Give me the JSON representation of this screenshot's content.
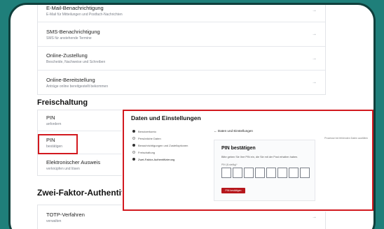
{
  "notifications": {
    "items": [
      {
        "title": "E-Mail-Benachrichtigung",
        "subtitle": "E-Mail für Mitteilungen und Postfach-Nachrichten"
      },
      {
        "title": "SMS-Benachrichtigung",
        "subtitle": "SMS für anstehende Termine"
      },
      {
        "title": "Online-Zustellung",
        "subtitle": "Bescheide, Nachweise und Schreiben"
      },
      {
        "title": "Online-Bereitstellung",
        "subtitle": "Anträge online bereitgestellt bekommen"
      }
    ],
    "arrow": "→"
  },
  "freischaltung": {
    "heading": "Freischaltung",
    "items": [
      {
        "title": "PIN",
        "subtitle": "anfordern"
      },
      {
        "title": "PIN",
        "subtitle": "bestätigen"
      },
      {
        "title": "Elektronischer Ausweis",
        "subtitle": "verknüpfen und lösen"
      }
    ]
  },
  "zwei_faktor": {
    "heading": "Zwei-Faktor-Authentif",
    "items": [
      {
        "title": "TOTP-Verfahren",
        "subtitle": "verwalten"
      }
    ]
  },
  "modal": {
    "title": "Daten und Einstellungen",
    "steps": [
      {
        "label": "Benutzerkonto",
        "state": "filled"
      },
      {
        "label": "Persönliche Daten",
        "state": "empty"
      },
      {
        "label": "Benachrichtigungen und Zustelloptionen",
        "state": "filled"
      },
      {
        "label": "Freischaltung",
        "state": "empty"
      },
      {
        "label": "Zwei-Faktor-Authentifizierung",
        "state": "filled"
      }
    ],
    "back_link": "← Daten und Einstellungen",
    "helper_link": "Prozesse bei fehlenden Daten ausfüllen",
    "pin_card": {
      "title": "PIN bestätigen",
      "text": "Bitte geben Sie Ihre PIN ein, die Sie mit der Post erhalten haben.",
      "label": "PIN (8-stellig)*",
      "box_count": 8,
      "submit": "PIN bestätigen"
    }
  },
  "colors": {
    "background": "#1f7f7a",
    "frame": "#0f3f3c",
    "highlight": "#d2191f",
    "submit": "#b6171c"
  }
}
